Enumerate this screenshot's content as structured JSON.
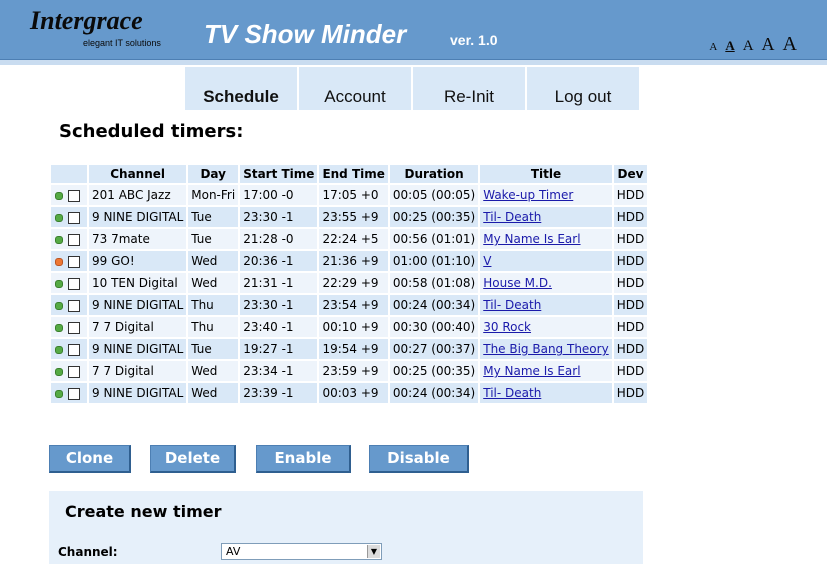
{
  "header": {
    "company": "Intergrace",
    "tagline": "elegant IT solutions",
    "app_title": "TV Show Minder",
    "version": "ver. 1.0",
    "font_sizes": [
      "A",
      "A",
      "A",
      "A",
      "A"
    ]
  },
  "tabs": [
    {
      "label": "Schedule",
      "active": true
    },
    {
      "label": "Account",
      "active": false
    },
    {
      "label": "Re-Init",
      "active": false
    },
    {
      "label": "Log out",
      "active": false
    }
  ],
  "schedule": {
    "heading": "Scheduled timers:",
    "columns": [
      "",
      "Channel",
      "Day",
      "Start Time",
      "End Time",
      "Duration",
      "Title",
      "Dev"
    ],
    "rows": [
      {
        "status": "green",
        "channel": "201 ABC Jazz",
        "day": "Mon-Fri",
        "start": "17:00 -0",
        "end": "17:05 +0",
        "duration": "00:05 (00:05)",
        "title": "Wake-up Timer",
        "dev": "HDD"
      },
      {
        "status": "green",
        "channel": "9 NINE DIGITAL",
        "day": "Tue",
        "start": "23:30 -1",
        "end": "23:55 +9",
        "duration": "00:25 (00:35)",
        "title": "Til- Death",
        "dev": "HDD"
      },
      {
        "status": "green",
        "channel": "73 7mate",
        "day": "Tue",
        "start": "21:28 -0",
        "end": "22:24 +5",
        "duration": "00:56 (01:01)",
        "title": "My Name Is Earl",
        "dev": "HDD"
      },
      {
        "status": "orange",
        "channel": "99 GO!",
        "day": "Wed",
        "start": "20:36 -1",
        "end": "21:36 +9",
        "duration": "01:00 (01:10)",
        "title": "V",
        "dev": "HDD"
      },
      {
        "status": "green",
        "channel": "10 TEN Digital",
        "day": "Wed",
        "start": "21:31 -1",
        "end": "22:29 +9",
        "duration": "00:58 (01:08)",
        "title": "House M.D.",
        "dev": "HDD"
      },
      {
        "status": "green",
        "channel": "9 NINE DIGITAL",
        "day": "Thu",
        "start": "23:30 -1",
        "end": "23:54 +9",
        "duration": "00:24 (00:34)",
        "title": "Til- Death",
        "dev": "HDD"
      },
      {
        "status": "green",
        "channel": "7 7 Digital",
        "day": "Thu",
        "start": "23:40 -1",
        "end": "00:10 +9",
        "duration": "00:30 (00:40)",
        "title": "30 Rock",
        "dev": "HDD"
      },
      {
        "status": "green",
        "channel": "9 NINE DIGITAL",
        "day": "Tue",
        "start": "19:27 -1",
        "end": "19:54 +9",
        "duration": "00:27 (00:37)",
        "title": "The Big Bang Theory",
        "dev": "HDD"
      },
      {
        "status": "green",
        "channel": "7 7 Digital",
        "day": "Wed",
        "start": "23:34 -1",
        "end": "23:59 +9",
        "duration": "00:25 (00:35)",
        "title": "My Name Is Earl",
        "dev": "HDD"
      },
      {
        "status": "green",
        "channel": "9 NINE DIGITAL",
        "day": "Wed",
        "start": "23:39 -1",
        "end": "00:03 +9",
        "duration": "00:24 (00:34)",
        "title": "Til- Death",
        "dev": "HDD"
      }
    ]
  },
  "actions": {
    "clone": "Clone",
    "delete": "Delete",
    "enable": "Enable",
    "disable": "Disable"
  },
  "create": {
    "heading": "Create new timer",
    "channel_label": "Channel:",
    "channel_value": "AV"
  },
  "colors": {
    "header_bg": "#6699cc",
    "tab_bg": "#d9e8f7",
    "row_odd": "#eef4fb",
    "row_even": "#d9e8f7",
    "status_green": "#55aa44",
    "status_orange": "#ee7733",
    "link": "#1a1aaa"
  }
}
